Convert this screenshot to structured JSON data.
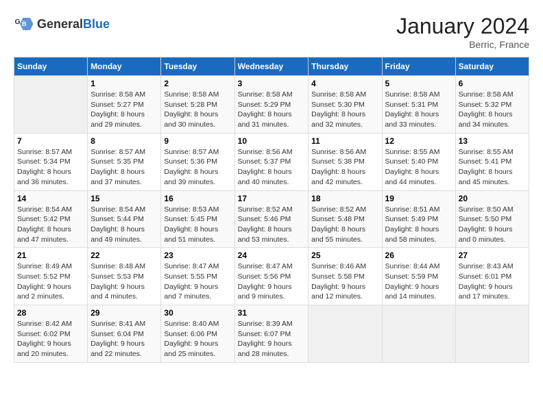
{
  "logo": {
    "text_general": "General",
    "text_blue": "Blue"
  },
  "title": "January 2024",
  "subtitle": "Berric, France",
  "days_of_week": [
    "Sunday",
    "Monday",
    "Tuesday",
    "Wednesday",
    "Thursday",
    "Friday",
    "Saturday"
  ],
  "weeks": [
    [
      {
        "day": "",
        "sunrise": "",
        "sunset": "",
        "daylight": ""
      },
      {
        "day": "1",
        "sunrise": "Sunrise: 8:58 AM",
        "sunset": "Sunset: 5:27 PM",
        "daylight": "Daylight: 8 hours and 29 minutes."
      },
      {
        "day": "2",
        "sunrise": "Sunrise: 8:58 AM",
        "sunset": "Sunset: 5:28 PM",
        "daylight": "Daylight: 8 hours and 30 minutes."
      },
      {
        "day": "3",
        "sunrise": "Sunrise: 8:58 AM",
        "sunset": "Sunset: 5:29 PM",
        "daylight": "Daylight: 8 hours and 31 minutes."
      },
      {
        "day": "4",
        "sunrise": "Sunrise: 8:58 AM",
        "sunset": "Sunset: 5:30 PM",
        "daylight": "Daylight: 8 hours and 32 minutes."
      },
      {
        "day": "5",
        "sunrise": "Sunrise: 8:58 AM",
        "sunset": "Sunset: 5:31 PM",
        "daylight": "Daylight: 8 hours and 33 minutes."
      },
      {
        "day": "6",
        "sunrise": "Sunrise: 8:58 AM",
        "sunset": "Sunset: 5:32 PM",
        "daylight": "Daylight: 8 hours and 34 minutes."
      }
    ],
    [
      {
        "day": "7",
        "sunrise": "Sunrise: 8:57 AM",
        "sunset": "Sunset: 5:34 PM",
        "daylight": "Daylight: 8 hours and 36 minutes."
      },
      {
        "day": "8",
        "sunrise": "Sunrise: 8:57 AM",
        "sunset": "Sunset: 5:35 PM",
        "daylight": "Daylight: 8 hours and 37 minutes."
      },
      {
        "day": "9",
        "sunrise": "Sunrise: 8:57 AM",
        "sunset": "Sunset: 5:36 PM",
        "daylight": "Daylight: 8 hours and 39 minutes."
      },
      {
        "day": "10",
        "sunrise": "Sunrise: 8:56 AM",
        "sunset": "Sunset: 5:37 PM",
        "daylight": "Daylight: 8 hours and 40 minutes."
      },
      {
        "day": "11",
        "sunrise": "Sunrise: 8:56 AM",
        "sunset": "Sunset: 5:38 PM",
        "daylight": "Daylight: 8 hours and 42 minutes."
      },
      {
        "day": "12",
        "sunrise": "Sunrise: 8:55 AM",
        "sunset": "Sunset: 5:40 PM",
        "daylight": "Daylight: 8 hours and 44 minutes."
      },
      {
        "day": "13",
        "sunrise": "Sunrise: 8:55 AM",
        "sunset": "Sunset: 5:41 PM",
        "daylight": "Daylight: 8 hours and 45 minutes."
      }
    ],
    [
      {
        "day": "14",
        "sunrise": "Sunrise: 8:54 AM",
        "sunset": "Sunset: 5:42 PM",
        "daylight": "Daylight: 8 hours and 47 minutes."
      },
      {
        "day": "15",
        "sunrise": "Sunrise: 8:54 AM",
        "sunset": "Sunset: 5:44 PM",
        "daylight": "Daylight: 8 hours and 49 minutes."
      },
      {
        "day": "16",
        "sunrise": "Sunrise: 8:53 AM",
        "sunset": "Sunset: 5:45 PM",
        "daylight": "Daylight: 8 hours and 51 minutes."
      },
      {
        "day": "17",
        "sunrise": "Sunrise: 8:52 AM",
        "sunset": "Sunset: 5:46 PM",
        "daylight": "Daylight: 8 hours and 53 minutes."
      },
      {
        "day": "18",
        "sunrise": "Sunrise: 8:52 AM",
        "sunset": "Sunset: 5:48 PM",
        "daylight": "Daylight: 8 hours and 55 minutes."
      },
      {
        "day": "19",
        "sunrise": "Sunrise: 8:51 AM",
        "sunset": "Sunset: 5:49 PM",
        "daylight": "Daylight: 8 hours and 58 minutes."
      },
      {
        "day": "20",
        "sunrise": "Sunrise: 8:50 AM",
        "sunset": "Sunset: 5:50 PM",
        "daylight": "Daylight: 9 hours and 0 minutes."
      }
    ],
    [
      {
        "day": "21",
        "sunrise": "Sunrise: 8:49 AM",
        "sunset": "Sunset: 5:52 PM",
        "daylight": "Daylight: 9 hours and 2 minutes."
      },
      {
        "day": "22",
        "sunrise": "Sunrise: 8:48 AM",
        "sunset": "Sunset: 5:53 PM",
        "daylight": "Daylight: 9 hours and 4 minutes."
      },
      {
        "day": "23",
        "sunrise": "Sunrise: 8:47 AM",
        "sunset": "Sunset: 5:55 PM",
        "daylight": "Daylight: 9 hours and 7 minutes."
      },
      {
        "day": "24",
        "sunrise": "Sunrise: 8:47 AM",
        "sunset": "Sunset: 5:56 PM",
        "daylight": "Daylight: 9 hours and 9 minutes."
      },
      {
        "day": "25",
        "sunrise": "Sunrise: 8:46 AM",
        "sunset": "Sunset: 5:58 PM",
        "daylight": "Daylight: 9 hours and 12 minutes."
      },
      {
        "day": "26",
        "sunrise": "Sunrise: 8:44 AM",
        "sunset": "Sunset: 5:59 PM",
        "daylight": "Daylight: 9 hours and 14 minutes."
      },
      {
        "day": "27",
        "sunrise": "Sunrise: 8:43 AM",
        "sunset": "Sunset: 6:01 PM",
        "daylight": "Daylight: 9 hours and 17 minutes."
      }
    ],
    [
      {
        "day": "28",
        "sunrise": "Sunrise: 8:42 AM",
        "sunset": "Sunset: 6:02 PM",
        "daylight": "Daylight: 9 hours and 20 minutes."
      },
      {
        "day": "29",
        "sunrise": "Sunrise: 8:41 AM",
        "sunset": "Sunset: 6:04 PM",
        "daylight": "Daylight: 9 hours and 22 minutes."
      },
      {
        "day": "30",
        "sunrise": "Sunrise: 8:40 AM",
        "sunset": "Sunset: 6:06 PM",
        "daylight": "Daylight: 9 hours and 25 minutes."
      },
      {
        "day": "31",
        "sunrise": "Sunrise: 8:39 AM",
        "sunset": "Sunset: 6:07 PM",
        "daylight": "Daylight: 9 hours and 28 minutes."
      },
      {
        "day": "",
        "sunrise": "",
        "sunset": "",
        "daylight": ""
      },
      {
        "day": "",
        "sunrise": "",
        "sunset": "",
        "daylight": ""
      },
      {
        "day": "",
        "sunrise": "",
        "sunset": "",
        "daylight": ""
      }
    ]
  ]
}
